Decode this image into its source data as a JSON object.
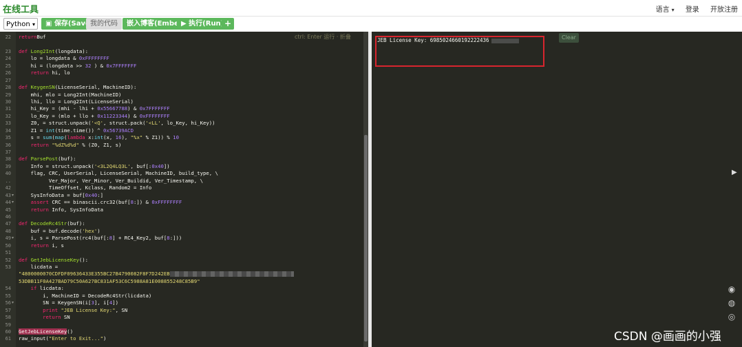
{
  "brand": "在线工具",
  "nav": {
    "language": "语言",
    "login": "登录",
    "register": "开放注册"
  },
  "toolbar": {
    "lang_select": "Python",
    "save": "保存(Save)",
    "my_code": "我的代码",
    "embed": "嵌入博客(Embed)",
    "run": "执行(Run)",
    "plus": "+"
  },
  "editor": {
    "hint": "ctrl: Enter 运行 · 折叠",
    "lines": [
      {
        "n": "22",
        "f": "",
        "c": [
          [
            "kw",
            "return"
          ],
          [
            "",
            "Buf"
          ]
        ]
      },
      {
        "n": "",
        "f": "",
        "c": [
          [
            "",
            ""
          ]
        ]
      },
      {
        "n": "23",
        "f": "",
        "c": [
          [
            "kw",
            "def "
          ],
          [
            "fn",
            "Long2Int"
          ],
          [
            "",
            "(longdata):"
          ]
        ]
      },
      {
        "n": "24",
        "f": "",
        "c": [
          [
            "",
            "    lo = longdata & "
          ],
          [
            "nb",
            "0xFFFFFFFF"
          ]
        ]
      },
      {
        "n": "25",
        "f": "",
        "c": [
          [
            "",
            "    hi = (longdata >> "
          ],
          [
            "nb",
            "32"
          ],
          [
            "",
            " ) & "
          ],
          [
            "nb",
            "0x7FFFFFFF"
          ]
        ]
      },
      {
        "n": "26",
        "f": "",
        "c": [
          [
            "kw",
            "    return "
          ],
          [
            "",
            "hi, lo"
          ]
        ]
      },
      {
        "n": "27",
        "f": "",
        "c": [
          [
            "",
            ""
          ]
        ]
      },
      {
        "n": "28",
        "f": "",
        "c": [
          [
            "kw",
            "def "
          ],
          [
            "fn",
            "KeygenSN"
          ],
          [
            "",
            "(LicenseSerial, MachineID):"
          ]
        ]
      },
      {
        "n": "29",
        "f": "",
        "c": [
          [
            "",
            "    mhi, mlo = Long2Int(MachineID)"
          ]
        ]
      },
      {
        "n": "30",
        "f": "",
        "c": [
          [
            "",
            "    lhi, llo = Long2Int(LicenseSerial)"
          ]
        ]
      },
      {
        "n": "31",
        "f": "",
        "c": [
          [
            "",
            "    hi_Key = (mhi - lhi + "
          ],
          [
            "nb",
            "0x55667788"
          ],
          [
            "",
            ") & "
          ],
          [
            "nb",
            "0x7FFFFFFF"
          ]
        ]
      },
      {
        "n": "32",
        "f": "",
        "c": [
          [
            "",
            "    lo_Key = (mlo + llo + "
          ],
          [
            "nb",
            "0x11223344"
          ],
          [
            "",
            ") & "
          ],
          [
            "nb",
            "0xFFFFFFFF"
          ]
        ]
      },
      {
        "n": "33",
        "f": "",
        "c": [
          [
            "",
            "    Z0, = struct.unpack("
          ],
          [
            "st",
            "'<Q'"
          ],
          [
            "",
            ", struct.pack("
          ],
          [
            "st",
            "'<LL'"
          ],
          [
            "",
            ", lo_Key, hi_Key))"
          ]
        ]
      },
      {
        "n": "34",
        "f": "",
        "c": [
          [
            "",
            "    Z1 = "
          ],
          [
            "bi",
            "int"
          ],
          [
            "",
            "(time.time()) ^ "
          ],
          [
            "nb",
            "0x56739ACD"
          ]
        ]
      },
      {
        "n": "35",
        "f": "",
        "c": [
          [
            "",
            "    s = "
          ],
          [
            "bi",
            "sum"
          ],
          [
            "",
            "("
          ],
          [
            "bi",
            "map"
          ],
          [
            "",
            "("
          ],
          [
            "kw",
            "lambda "
          ],
          [
            "",
            "x:"
          ],
          [
            "bi",
            "int"
          ],
          [
            "",
            "(x, "
          ],
          [
            "nb",
            "16"
          ],
          [
            "",
            "), "
          ],
          [
            "st",
            "\"%x\""
          ],
          [
            "",
            " % Z1)) % "
          ],
          [
            "nb",
            "10"
          ]
        ]
      },
      {
        "n": "36",
        "f": "",
        "c": [
          [
            "kw",
            "    return "
          ],
          [
            "st",
            "\"%dZ%d%d\""
          ],
          [
            "",
            " % (Z0, Z1, s)"
          ]
        ]
      },
      {
        "n": "37",
        "f": "",
        "c": [
          [
            "",
            ""
          ]
        ]
      },
      {
        "n": "38",
        "f": "",
        "c": [
          [
            "kw",
            "def "
          ],
          [
            "fn",
            "ParsePost"
          ],
          [
            "",
            "(buf):"
          ]
        ]
      },
      {
        "n": "39",
        "f": "",
        "c": [
          [
            "",
            "    Info = struct.unpack("
          ],
          [
            "st",
            "'<3L2Q4LQ3L'"
          ],
          [
            "",
            ", buf[:"
          ],
          [
            "nb",
            "0x40"
          ],
          [
            "",
            "])"
          ]
        ]
      },
      {
        "n": "40",
        "f": "",
        "c": [
          [
            "",
            "    flag, CRC, UserSerial, LicenseSerial, MachineID, build_type, \\"
          ]
        ]
      },
      {
        "n": "..",
        "f": "",
        "c": [
          [
            "",
            "          Ver_Major, Ver_Minor, Ver_Buildid, Ver_Timestamp, \\"
          ]
        ]
      },
      {
        "n": "42",
        "f": "",
        "c": [
          [
            "",
            "          TimeOffset, Kclass, Random2 = Info"
          ]
        ]
      },
      {
        "n": "43",
        "f": "▾",
        "c": [
          [
            "",
            "    SysInfoData = buf["
          ],
          [
            "nb",
            "0x40"
          ],
          [
            "",
            ":]"
          ]
        ]
      },
      {
        "n": "44",
        "f": "▾",
        "c": [
          [
            "kw",
            "    assert "
          ],
          [
            "",
            "CRC == binascii.crc32(buf["
          ],
          [
            "nb",
            "8"
          ],
          [
            "",
            ":]) & "
          ],
          [
            "nb",
            "0xFFFFFFFF"
          ]
        ]
      },
      {
        "n": "45",
        "f": "",
        "c": [
          [
            "kw",
            "    return "
          ],
          [
            "",
            "Info, SysInfoData"
          ]
        ]
      },
      {
        "n": "46",
        "f": "",
        "c": [
          [
            "",
            ""
          ]
        ]
      },
      {
        "n": "47",
        "f": "",
        "c": [
          [
            "kw",
            "def "
          ],
          [
            "fn",
            "DecodeRc4Str"
          ],
          [
            "",
            "(buf):"
          ]
        ]
      },
      {
        "n": "48",
        "f": "",
        "c": [
          [
            "",
            "    buf = buf.decode("
          ],
          [
            "st",
            "'hex'"
          ],
          [
            "",
            ")"
          ]
        ]
      },
      {
        "n": "49",
        "f": "▾",
        "c": [
          [
            "",
            "    i, s = ParsePost(rc4(buf[:"
          ],
          [
            "nb",
            "8"
          ],
          [
            "",
            "] + RC4_Key2, buf["
          ],
          [
            "nb",
            "8"
          ],
          [
            "",
            ":]))"
          ]
        ]
      },
      {
        "n": "50",
        "f": "",
        "c": [
          [
            "kw",
            "    return "
          ],
          [
            "",
            "i, s"
          ]
        ]
      },
      {
        "n": "51",
        "f": "",
        "c": [
          [
            "",
            ""
          ]
        ]
      },
      {
        "n": "52",
        "f": "",
        "c": [
          [
            "kw",
            "def "
          ],
          [
            "fn",
            "GetJebLicenseKey"
          ],
          [
            "",
            "():"
          ]
        ]
      },
      {
        "n": "53",
        "f": "",
        "c": [
          [
            "",
            "    licdata ="
          ]
        ]
      },
      {
        "n": "",
        "f": "",
        "c": [
          [
            "st",
            "\"4800000070CDFDF09636433E355BC27B4790082F8F7D242EB"
          ],
          [
            "blur",
            ""
          ]
        ]
      },
      {
        "n": "",
        "f": "",
        "c": [
          [
            "st",
            "53DBB11F0A427BAD79C50A627BC831AF53C6C5988A81E008855248C85B9\""
          ]
        ]
      },
      {
        "n": "54",
        "f": "",
        "c": [
          [
            "kw",
            "    if "
          ],
          [
            "",
            "licdata:"
          ]
        ]
      },
      {
        "n": "55",
        "f": "",
        "c": [
          [
            "",
            "        i, MachineID = DecodeRc4Str(licdata)"
          ]
        ]
      },
      {
        "n": "56",
        "f": "▾",
        "c": [
          [
            "",
            "        SN = KeygenSN(i["
          ],
          [
            "nb",
            "3"
          ],
          [
            "",
            "], i["
          ],
          [
            "nb",
            "4"
          ],
          [
            "",
            "])"
          ]
        ]
      },
      {
        "n": "57",
        "f": "",
        "c": [
          [
            "kw",
            "        print "
          ],
          [
            "st",
            "\"JEB License Key:\""
          ],
          [
            "",
            ", SN"
          ]
        ]
      },
      {
        "n": "58",
        "f": "",
        "c": [
          [
            "kw",
            "        return "
          ],
          [
            "",
            "SN"
          ]
        ]
      },
      {
        "n": "59",
        "f": "",
        "c": [
          [
            "",
            ""
          ]
        ]
      },
      {
        "n": "60",
        "f": "",
        "c": [
          [
            "hlcall",
            "GetJebLicenseKey"
          ],
          [
            "",
            "()"
          ]
        ]
      },
      {
        "n": "61",
        "f": "",
        "c": [
          [
            "",
            "raw_input("
          ],
          [
            "st",
            "\"Enter to Exit...\""
          ],
          [
            "",
            ")"
          ]
        ]
      }
    ]
  },
  "output": {
    "text": "JEB License Key: 6985024660192222436",
    "clear": "Clear"
  },
  "side_icons": [
    "qq-icon",
    "wechat-icon",
    "weibo-icon"
  ],
  "watermark": "CSDN @画画的小强"
}
